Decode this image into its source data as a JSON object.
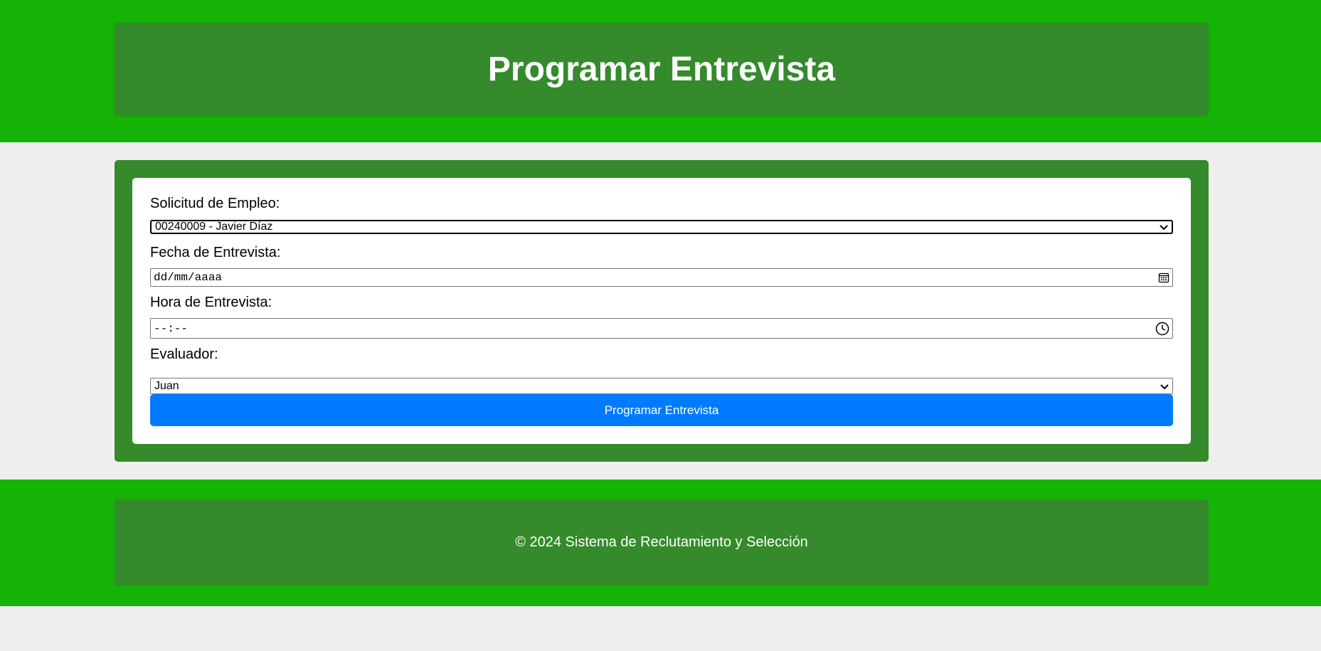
{
  "header": {
    "title": "Programar Entrevista"
  },
  "form": {
    "solicitud_label": "Solicitud de Empleo:",
    "solicitud_selected": "00240009 - Javier Díaz",
    "fecha_label": "Fecha de Entrevista:",
    "fecha_placeholder": "dd/mm/aaaa",
    "hora_label": "Hora de Entrevista:",
    "hora_placeholder": "--:--",
    "evaluador_label": "Evaluador:",
    "evaluador_selected": "Juan",
    "submit_label": "Programar Entrevista"
  },
  "footer": {
    "text": "© 2024 Sistema de Reclutamiento y Selección"
  },
  "icons": {
    "select_arrow": "chevron-down-icon",
    "date_picker": "calendar-icon",
    "time_picker": "clock-icon"
  },
  "colors": {
    "band_green": "#15b306",
    "panel_green": "#358a2c",
    "button_blue": "#007bff",
    "page_bg": "#efefef"
  }
}
